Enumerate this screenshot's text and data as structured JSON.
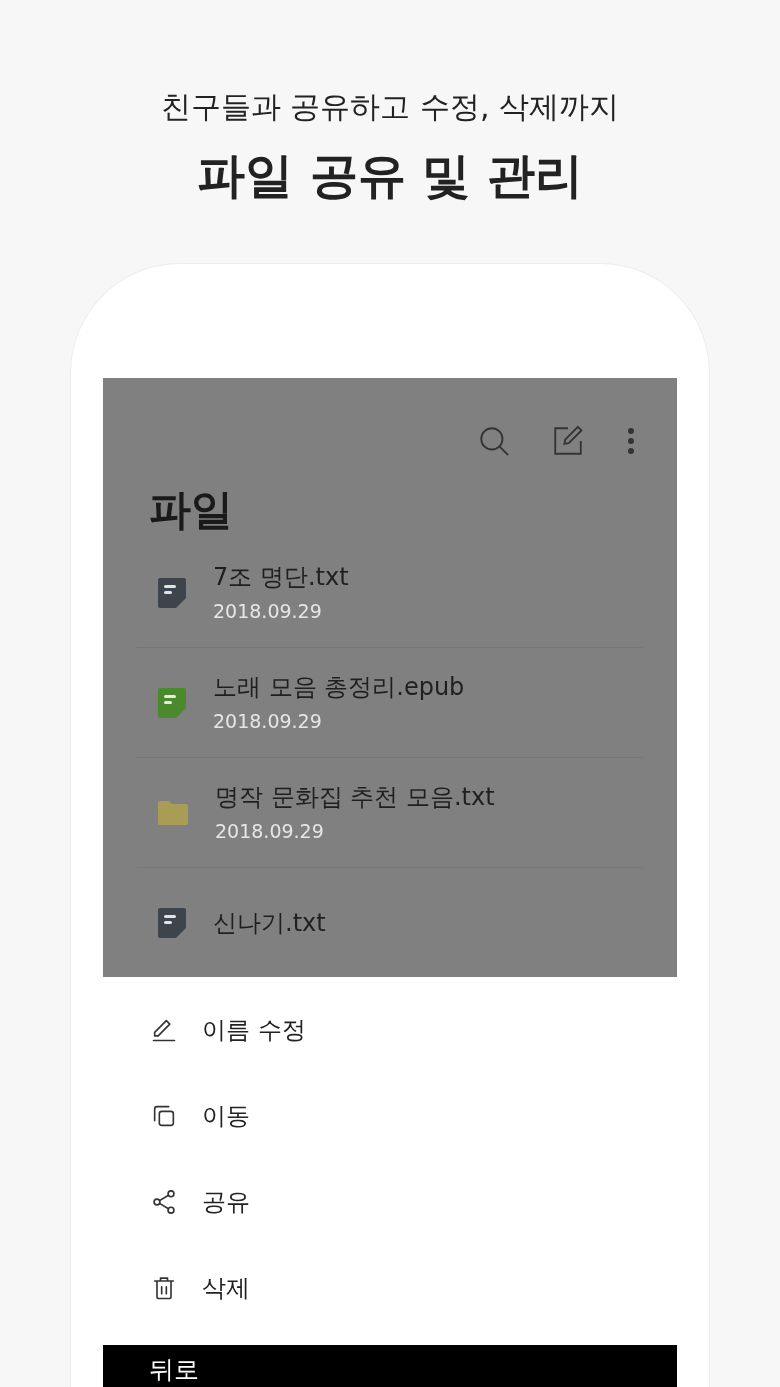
{
  "promo": {
    "subtitle": "친구들과 공유하고 수정, 삭제까지",
    "title": "파일 공유 및 관리"
  },
  "screen": {
    "title": "파일",
    "dimmed": true,
    "files": [
      {
        "kind": "document",
        "color": "#3e444b",
        "name": "7조 명단.txt",
        "date": "2018.09.29"
      },
      {
        "kind": "document",
        "color": "#4b8a2c",
        "name": "노래 모음 총정리.epub",
        "date": "2018.09.29"
      },
      {
        "kind": "folder",
        "color": "#a99c54",
        "name": "명작 문화집 추천 모음.txt",
        "date": "2018.09.29"
      },
      {
        "kind": "document",
        "color": "#3e444b",
        "name": "신나기.txt"
      }
    ]
  },
  "action_sheet": {
    "items": [
      {
        "kind": "rename",
        "label": "이름 수정"
      },
      {
        "kind": "move",
        "label": "이동"
      },
      {
        "kind": "share",
        "label": "공유"
      },
      {
        "kind": "delete",
        "label": "삭제"
      }
    ],
    "back": "뒤로"
  }
}
